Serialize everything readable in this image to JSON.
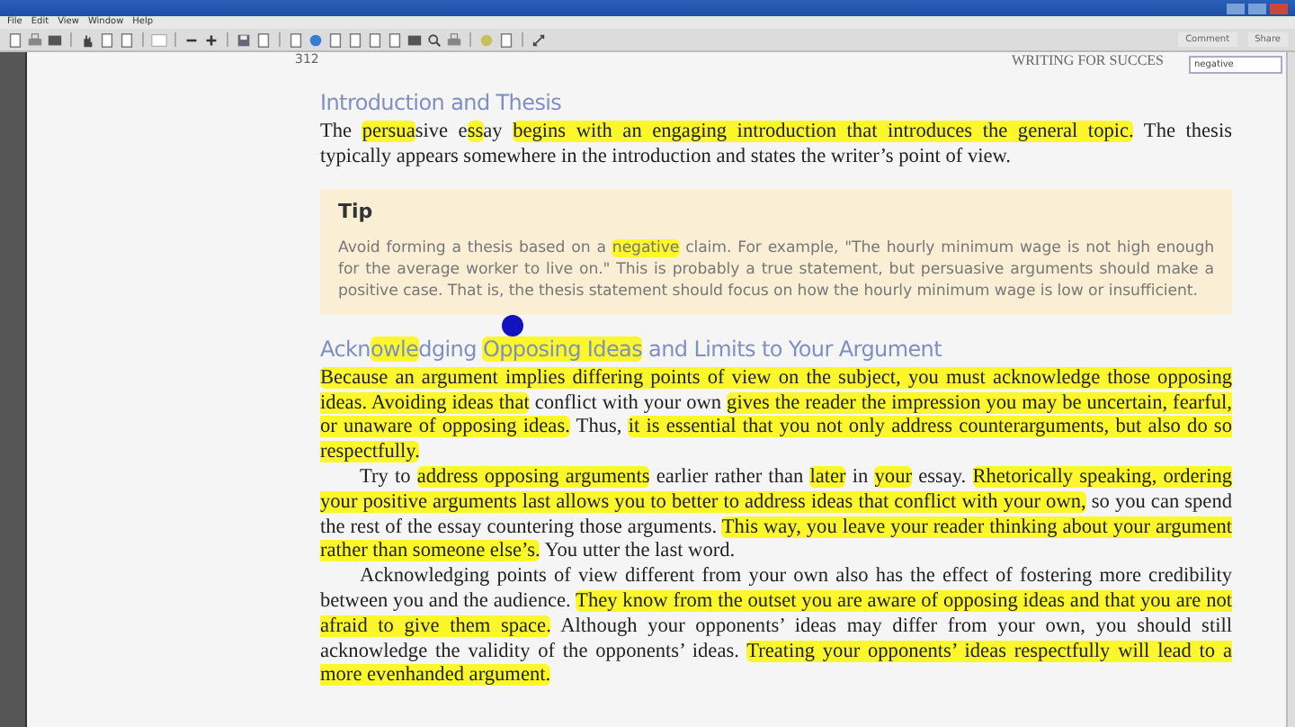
{
  "menu": [
    "File",
    "Edit",
    "View",
    "Window",
    "Help"
  ],
  "toolbar": {
    "buttons": [
      "Comment",
      "Share"
    ]
  },
  "search": {
    "value": "negative"
  },
  "page": {
    "number": "312",
    "running_head": "WRITING FOR SUCCES"
  },
  "sections": [
    {
      "heading": [
        {
          "text": "Introduction and Thesis",
          "highlighted": false
        }
      ],
      "paragraphs": [
        {
          "indent": false,
          "segments": [
            {
              "text": "The ",
              "highlighted": false
            },
            {
              "text": "persua",
              "highlighted": true
            },
            {
              "text": "sive e",
              "highlighted": false
            },
            {
              "text": "ss",
              "highlighted": true
            },
            {
              "text": "ay ",
              "highlighted": false
            },
            {
              "text": "begins with an engaging introduction that introduces the general topic.",
              "highlighted": true
            },
            {
              "text": " The thesis typically appears somewhere in the introduction and states the writer’s point of view.",
              "highlighted": false
            }
          ]
        }
      ],
      "tip": {
        "title": "Tip",
        "segments": [
          {
            "text": "Avoid forming a thesis based on a ",
            "highlighted": false
          },
          {
            "text": "negative",
            "highlighted": true
          },
          {
            "text": " claim. For example, \"The hourly minimum wage is not high enough for the average worker to live on.\" This is probably a true statement, but persuasive arguments should make a positive case. That is, the thesis statement should focus on how the hourly minimum wage is low or insufficient.",
            "highlighted": false
          }
        ]
      }
    },
    {
      "heading": [
        {
          "text": "Ackn",
          "highlighted": false
        },
        {
          "text": "owle",
          "highlighted": true
        },
        {
          "text": "dging ",
          "highlighted": false
        },
        {
          "text": "Opposing Ideas",
          "highlighted": true
        },
        {
          "text": " and Limits to Your Argument",
          "highlighted": false
        }
      ],
      "paragraphs": [
        {
          "indent": false,
          "segments": [
            {
              "text": "Because an argument implies differing points of view on the subject, you must acknowledge those opposing ideas. Avoiding ideas that",
              "highlighted": true
            },
            {
              "text": " conflict with your own ",
              "highlighted": false
            },
            {
              "text": "gives the reader the impression you may be uncertain, fearful, or unaware of opposing ideas.",
              "highlighted": true
            },
            {
              "text": " Thus, ",
              "highlighted": false
            },
            {
              "text": "it is essential that you not only address counterarguments, but also do so respectfully.",
              "highlighted": true
            }
          ]
        },
        {
          "indent": true,
          "segments": [
            {
              "text": "Try to ",
              "highlighted": false
            },
            {
              "text": "address opposing arguments",
              "highlighted": true
            },
            {
              "text": " earlier rather than ",
              "highlighted": false
            },
            {
              "text": "later",
              "highlighted": true
            },
            {
              "text": " in ",
              "highlighted": false
            },
            {
              "text": "your",
              "highlighted": true
            },
            {
              "text": " essay. ",
              "highlighted": false
            },
            {
              "text": "Rhetorically speaking, ordering your positive arguments last allows you to better to address ideas that conflict with your own,",
              "highlighted": true
            },
            {
              "text": " so you can spend the rest of the essay countering those arguments. ",
              "highlighted": false
            },
            {
              "text": "This way, you leave your reader thinking about your argument rather than someone else’s.",
              "highlighted": true
            },
            {
              "text": " You utter the last word.",
              "highlighted": false
            }
          ]
        },
        {
          "indent": true,
          "segments": [
            {
              "text": "Acknowledging points of view different from your own also has the effect of fostering more credibility between you and the audience. ",
              "highlighted": false
            },
            {
              "text": "They know from the outset you are aware of opposing ideas and that you are not afraid to give them space.",
              "highlighted": true
            },
            {
              "text": " Although your opponents’ ideas may differ from your own, you should still acknowledge the validity of the opponents’ ideas. ",
              "highlighted": false
            },
            {
              "text": "Treating your opponents’ ideas respectfully will lead to a more evenhanded argument.",
              "highlighted": true
            }
          ]
        }
      ]
    }
  ]
}
